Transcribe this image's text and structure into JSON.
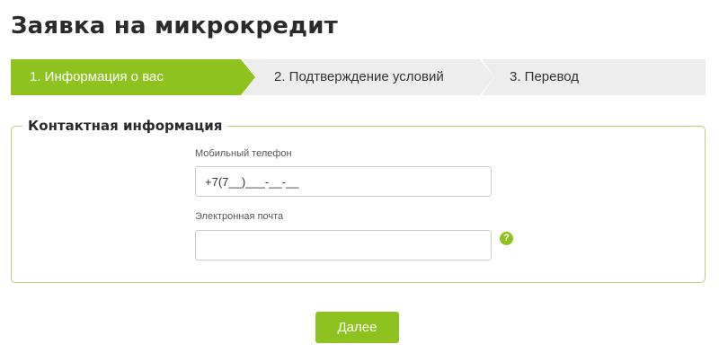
{
  "page": {
    "title": "Заявка на микрокредит"
  },
  "steps": [
    {
      "label": "1. Информация о вас",
      "active": true
    },
    {
      "label": "2. Подтверждение условий",
      "active": false
    },
    {
      "label": "3. Перевод",
      "active": false
    }
  ],
  "contact": {
    "legend": "Контактная информация",
    "phone": {
      "label": "Мобильный телефон",
      "value": "+7(7__)___-__-__"
    },
    "email": {
      "label": "Электронная почта",
      "value": ""
    },
    "help_icon": "question-mark-icon",
    "help_glyph": "?"
  },
  "actions": {
    "next_label": "Далее"
  },
  "colors": {
    "accent": "#8dc21f",
    "inactive_step": "#ededed",
    "border": "#b5d17a"
  }
}
